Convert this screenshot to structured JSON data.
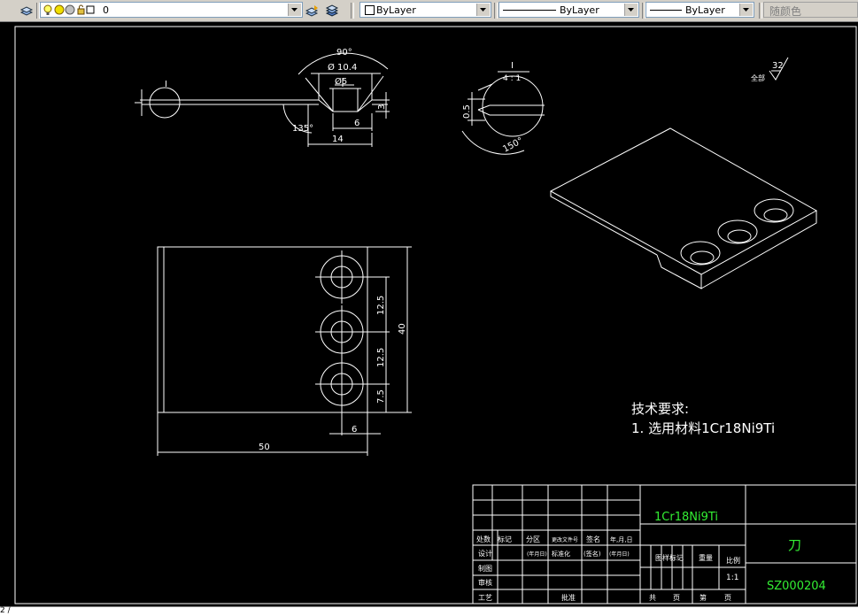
{
  "toolbar": {
    "layer_name": "0",
    "color_combo": "ByLayer",
    "linetype_combo": "ByLayer",
    "lineweight_combo": "ByLayer",
    "plotstyle_combo": "随颜色"
  },
  "drawing": {
    "dims": {
      "angle_90": "90°",
      "dia_10_4": "Ø 10.4",
      "dia_5": "Ø5",
      "d3": "3",
      "d6_top": "6",
      "d14": "14",
      "angle_135": "135°",
      "label_I": "I",
      "detail_label": "I",
      "detail_scale": "4 : 1",
      "d05": "0.5",
      "angle_150": "150°",
      "rough_value": "32",
      "rough_prefix": "全部",
      "d12_5_a": "12.5",
      "d12_5_b": "12.5",
      "d7_5": "7.5",
      "d40": "40",
      "d6_bottom": "6",
      "d50": "50"
    },
    "tech": {
      "heading": "技术要求:",
      "line1": "1. 选用材料1Cr18Ni9Ti"
    },
    "title_block": {
      "material": "1Cr18Ni9Ti",
      "part_name": "刀",
      "drawing_no": "SZ000204",
      "scale": "1:1",
      "hdr_chuliang": "处数",
      "hdr_biaoji": "标记",
      "hdr_fenqu": "分区",
      "hdr_gengai": "更改文件号",
      "hdr_qianming": "签名",
      "hdr_date": "年,月,日",
      "row_sheji": "设计",
      "row_nianyueri": "(年月日)",
      "row_biaozhunhua": "标准化",
      "row_qianming2": "(签名)",
      "row_nianyueri2": "(年月日)",
      "row_zhitu": "制图",
      "row_shenhe": "审核",
      "row_gongyi": "工艺",
      "row_pizhun": "批准",
      "tuyang": "图样标记",
      "zhongliang": "重量",
      "bili": "比例",
      "gong": "共",
      "zhang1": "页",
      "di": "第",
      "zhang2": "页"
    }
  },
  "status": {
    "text": "2 /"
  }
}
